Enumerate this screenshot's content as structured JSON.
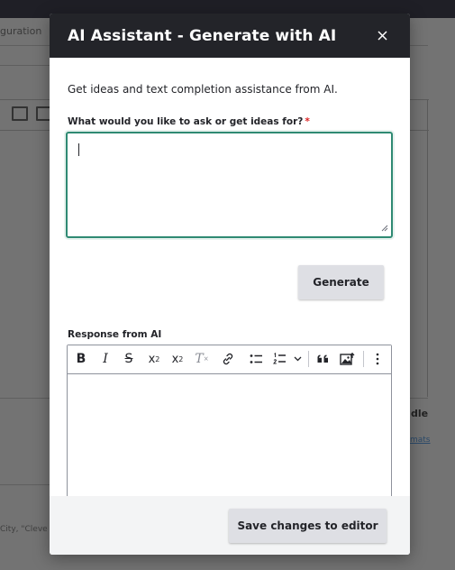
{
  "background": {
    "tab_text": "guration",
    "idle_text": "dle",
    "link_text": "mats",
    "hint_text": "City, \"Cleve"
  },
  "modal": {
    "title": "AI Assistant - Generate with AI",
    "close_icon": "close-icon",
    "intro": "Get ideas and text completion assistance from AI.",
    "prompt": {
      "label": "What would you like to ask or get ideas for?",
      "required_marker": "*",
      "value": "",
      "placeholder": ""
    },
    "generate_label": "Generate",
    "response": {
      "label": "Response from AI",
      "toolbar": [
        "bold-icon",
        "italic-icon",
        "strikethrough-icon",
        "superscript-icon",
        "subscript-icon",
        "remove-format-icon",
        "link-icon",
        "bulleted-list-icon",
        "numbered-list-icon",
        "block-quote-icon",
        "insert-image-icon",
        "more-options-icon"
      ],
      "value": ""
    },
    "save_label": "Save changes to editor"
  },
  "colors": {
    "header_bg": "#232429",
    "focus_border": "#2f8a73",
    "required": "#dc2323",
    "button_bg": "#dedfe4"
  }
}
